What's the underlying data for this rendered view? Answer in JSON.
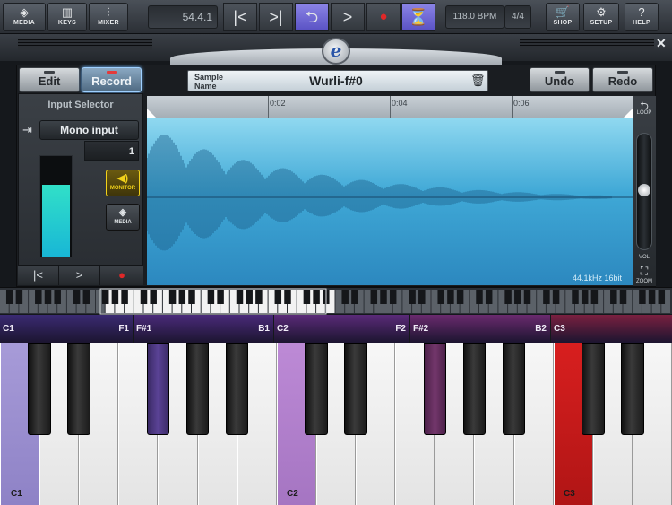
{
  "toolbar": {
    "media": {
      "label": "MEDIA",
      "icon": "media-icon"
    },
    "keys": {
      "label": "KEYS",
      "icon": "keys-icon"
    },
    "mixer": {
      "label": "MIXER",
      "icon": "mixer-icon"
    },
    "position": "54.4.1",
    "tempo": "118.0 BPM",
    "time_signature": "4/4",
    "shop": {
      "label": "SHOP",
      "icon": "cart-icon"
    },
    "setup": {
      "label": "SETUP",
      "icon": "gear-icon"
    },
    "help": {
      "label": "HELP",
      "icon": "help-icon"
    }
  },
  "editor": {
    "edit_label": "Edit",
    "record_label": "Record",
    "sample_label_line1": "Sample",
    "sample_label_line2": "Name",
    "sample_name": "Wurli-f#0",
    "undo_label": "Undo",
    "redo_label": "Redo",
    "input_selector_title": "Input Selector",
    "input_value": "Mono input",
    "channel": "1",
    "input_level": 0.72,
    "monitor_label": "MONITOR",
    "media_label": "MEDIA",
    "timeline_ticks": [
      "0:02",
      "0:04",
      "0:06"
    ],
    "format": "44.1kHz  16bit",
    "loop_label": "LOOP",
    "vol_label": "VOL",
    "zoom_label": "ZOOM"
  },
  "zones": [
    {
      "start": "C1",
      "end": "F1",
      "color": "#3a2a72"
    },
    {
      "start": "F#1",
      "end": "B1",
      "color": "#4a2a7a"
    },
    {
      "start": "C2",
      "end": "F2",
      "color": "#5a2a78"
    },
    {
      "start": "F#2",
      "end": "B2",
      "color": "#6a2a6e"
    },
    {
      "start": "C3",
      "end": "",
      "color": "#7a2040"
    }
  ],
  "keyboard_labels": {
    "c1": "C1",
    "c2": "C2",
    "c3": "C3"
  },
  "colors": {
    "accent": "#6a63d8",
    "record_red": "#e02828",
    "c1_key": "#a79bd8",
    "c2_key": "#bd8ad6",
    "c3_key": "#d81f1f",
    "waveform": "#3fa8d6"
  }
}
